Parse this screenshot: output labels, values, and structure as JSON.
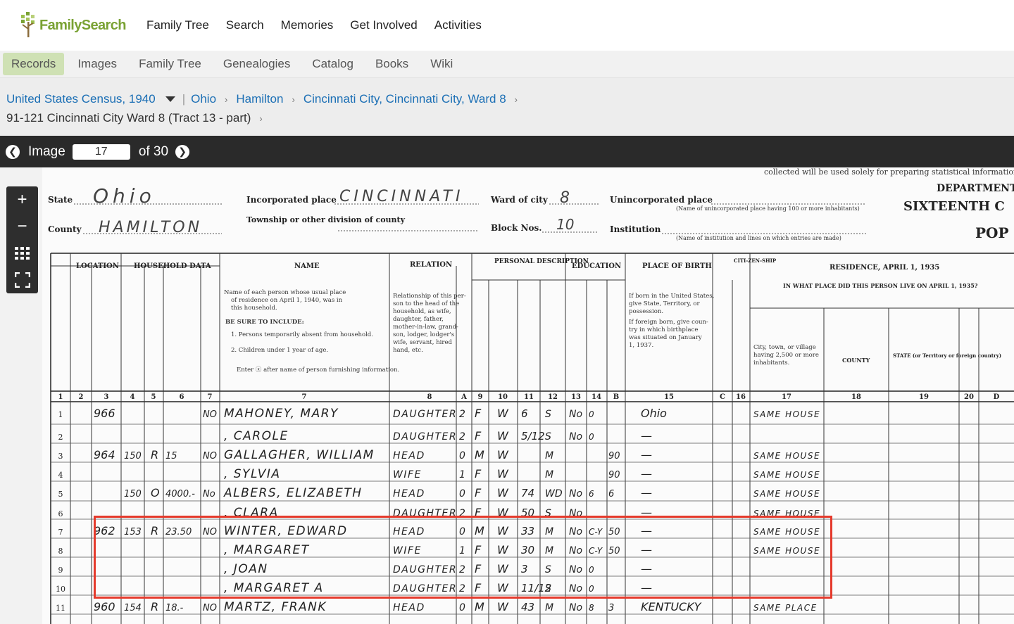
{
  "brand": {
    "name": "FamilySearch"
  },
  "main_nav": [
    "Family Tree",
    "Search",
    "Memories",
    "Get Involved",
    "Activities"
  ],
  "sub_nav": [
    "Records",
    "Images",
    "Family Tree",
    "Genealogies",
    "Catalog",
    "Books",
    "Wiki"
  ],
  "sub_nav_active": "Records",
  "breadcrumb": {
    "collection": "United States Census, 1940",
    "state": "Ohio",
    "county": "Hamilton",
    "city": "Cincinnati City, Cincinnati City, Ward 8",
    "district": "91-121 Cincinnati City Ward 8 (Tract 13 - part)"
  },
  "image_bar": {
    "label": "Image",
    "current": "17",
    "of_label": "of 30"
  },
  "tools": [
    "zoom-in",
    "zoom-out",
    "grid",
    "fullscreen"
  ],
  "census": {
    "state_label": "State",
    "state": "Ohio",
    "county_label": "County",
    "county": "HAMILTON",
    "inc_label": "Incorporated place",
    "inc_place": "CINCINNATI",
    "twp_label": "Township or other division of county",
    "ward_label": "Ward of city",
    "ward": "8",
    "block_label": "Block Nos.",
    "block": "10",
    "uninc_label": "Unincorporated place",
    "inst_label": "Institution",
    "dept": "DEPARTMENT",
    "sixteenth": "SIXTEENTH C",
    "pop": "POP",
    "headers": {
      "location": "LOCATION",
      "household": "HOUSEHOLD DATA",
      "name": "NAME",
      "relation": "RELATION",
      "personal": "PERSONAL DESCRIPTION",
      "education": "EDUCATION",
      "birth": "PLACE OF BIRTH",
      "citizen": "CITI-ZEN-SHIP",
      "residence": "RESIDENCE, APRIL 1, 1935",
      "in_what_place": "IN WHAT PLACE DID THIS PERSON LIVE ON APRIL 1, 1935?",
      "county_col": "COUNTY",
      "state_col": "STATE (or Territory or foreign country)"
    },
    "col_nums": [
      "1",
      "2",
      "3",
      "4",
      "5",
      "6",
      "7",
      "8",
      "A",
      "9",
      "10",
      "11",
      "12",
      "13",
      "14",
      "B",
      "15",
      "C",
      "16",
      "17",
      "18",
      "19",
      "20",
      "D"
    ],
    "rows": [
      {
        "line": "1",
        "house": "966",
        "num": "",
        "own": "",
        "val": "",
        "farm": "NO",
        "name": "MAHONEY, MARY",
        "rel": "DAUGHTER",
        "code": "2",
        "sex": "F",
        "race": "W",
        "age": "6",
        "mar": "S",
        "sch": "No",
        "grade": "0",
        "gc": "",
        "birth": "Ohio",
        "res": "SAME HOUSE"
      },
      {
        "line": "2",
        "house": "",
        "num": "",
        "own": "",
        "val": "",
        "farm": "",
        "name": ", CAROLE",
        "rel": "DAUGHTER",
        "code": "2",
        "sex": "F",
        "race": "W",
        "age": "5/12",
        "mar": "S",
        "sch": "No",
        "grade": "0",
        "gc": "",
        "birth": "—",
        "res": ""
      },
      {
        "line": "3",
        "house": "964",
        "num": "150",
        "own": "R",
        "val": "15",
        "farm": "NO",
        "name": "GALLAGHER, WILLIAM",
        "rel": "HEAD",
        "code": "0",
        "sex": "M",
        "race": "W",
        "age": "",
        "mar": "M",
        "sch": "",
        "grade": "",
        "gc": "90",
        "birth": "—",
        "res": "SAME HOUSE"
      },
      {
        "line": "4",
        "house": "",
        "num": "",
        "own": "",
        "val": "",
        "farm": "",
        "name": ", SYLVIA",
        "rel": "WIFE",
        "code": "1",
        "sex": "F",
        "race": "W",
        "age": "",
        "mar": "M",
        "sch": "",
        "grade": "",
        "gc": "90",
        "birth": "—",
        "res": "SAME HOUSE"
      },
      {
        "line": "5",
        "house": "",
        "num": "150",
        "own": "O",
        "val": "4000.-",
        "farm": "No",
        "name": "ALBERS, ELIZABETH",
        "rel": "HEAD",
        "code": "0",
        "sex": "F",
        "race": "W",
        "age": "74",
        "mar": "WD",
        "sch": "No",
        "grade": "6",
        "gc": "6",
        "birth": "—",
        "res": "SAME HOUSE"
      },
      {
        "line": "6",
        "house": "",
        "num": "",
        "own": "",
        "val": "",
        "farm": "",
        "name": ", CLARA",
        "rel": "DAUGHTER",
        "code": "2",
        "sex": "F",
        "race": "W",
        "age": "50",
        "mar": "S",
        "sch": "No",
        "grade": "",
        "gc": "",
        "birth": "—",
        "res": "SAME HOUSE"
      },
      {
        "line": "7",
        "house": "962",
        "num": "153",
        "own": "R",
        "val": "23.50",
        "farm": "NO",
        "name": "WINTER, EDWARD",
        "rel": "HEAD",
        "code": "0",
        "sex": "M",
        "race": "W",
        "age": "33",
        "mar": "M",
        "sch": "No",
        "grade": "C-Y",
        "gc": "50",
        "birth": "—",
        "res": "SAME HOUSE"
      },
      {
        "line": "8",
        "house": "",
        "num": "",
        "own": "",
        "val": "",
        "farm": "",
        "name": ", MARGARET",
        "rel": "WIFE",
        "code": "1",
        "sex": "F",
        "race": "W",
        "age": "30",
        "mar": "M",
        "sch": "No",
        "grade": "C-Y",
        "gc": "50",
        "birth": "—",
        "res": "SAME HOUSE"
      },
      {
        "line": "9",
        "house": "",
        "num": "",
        "own": "",
        "val": "",
        "farm": "",
        "name": ", JOAN",
        "rel": "DAUGHTER",
        "code": "2",
        "sex": "F",
        "race": "W",
        "age": "3",
        "mar": "S",
        "sch": "No",
        "grade": "0",
        "gc": "",
        "birth": "—",
        "res": ""
      },
      {
        "line": "10",
        "house": "",
        "num": "",
        "own": "",
        "val": "",
        "farm": "",
        "name": ", MARGARET A",
        "rel": "DAUGHTER",
        "code": "2",
        "sex": "F",
        "race": "W",
        "age": "11/12",
        "mar": "S",
        "sch": "No",
        "grade": "0",
        "gc": "",
        "birth": "—",
        "res": ""
      },
      {
        "line": "11",
        "house": "960",
        "num": "154",
        "own": "R",
        "val": "18.-",
        "farm": "NO",
        "name": "MARTZ, FRANK",
        "rel": "HEAD",
        "code": "0",
        "sex": "M",
        "race": "W",
        "age": "43",
        "mar": "M",
        "sch": "No",
        "grade": "8",
        "gc": "3",
        "birth": "KENTUCKY",
        "res": "SAME PLACE"
      }
    ]
  },
  "colors": {
    "brand_green": "#7aa234",
    "link_blue": "#1b6fb5",
    "highlight_red": "#e53a2c",
    "active_tab": "#cfe1b4"
  }
}
